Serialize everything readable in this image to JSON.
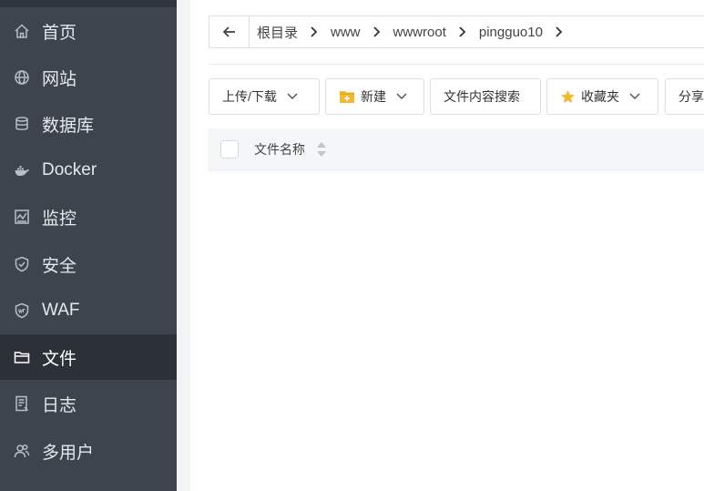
{
  "sidebar": {
    "items": [
      {
        "label": "首页",
        "icon": "home-icon"
      },
      {
        "label": "网站",
        "icon": "globe-icon"
      },
      {
        "label": "数据库",
        "icon": "database-icon"
      },
      {
        "label": "Docker",
        "icon": "docker-icon"
      },
      {
        "label": "监控",
        "icon": "monitor-icon"
      },
      {
        "label": "安全",
        "icon": "shield-icon"
      },
      {
        "label": "WAF",
        "icon": "waf-shield-icon"
      },
      {
        "label": "文件",
        "icon": "folder-icon",
        "active": true
      },
      {
        "label": "日志",
        "icon": "log-icon"
      },
      {
        "label": "多用户",
        "icon": "users-icon"
      }
    ]
  },
  "breadcrumb": {
    "items": [
      "根目录",
      "www",
      "wwwroot",
      "pingguo10"
    ]
  },
  "toolbar": {
    "upload_download": "上传/下载",
    "new": "新建",
    "content_search": "文件内容搜索",
    "favorites": "收藏夹",
    "share": "分享"
  },
  "table": {
    "column_name": "文件名称"
  },
  "colors": {
    "sidebar_bg": "#3c444d",
    "sidebar_active_bg": "#2b3137",
    "folder_yellow": "#f5b82e",
    "star_yellow": "#f5b82e"
  }
}
